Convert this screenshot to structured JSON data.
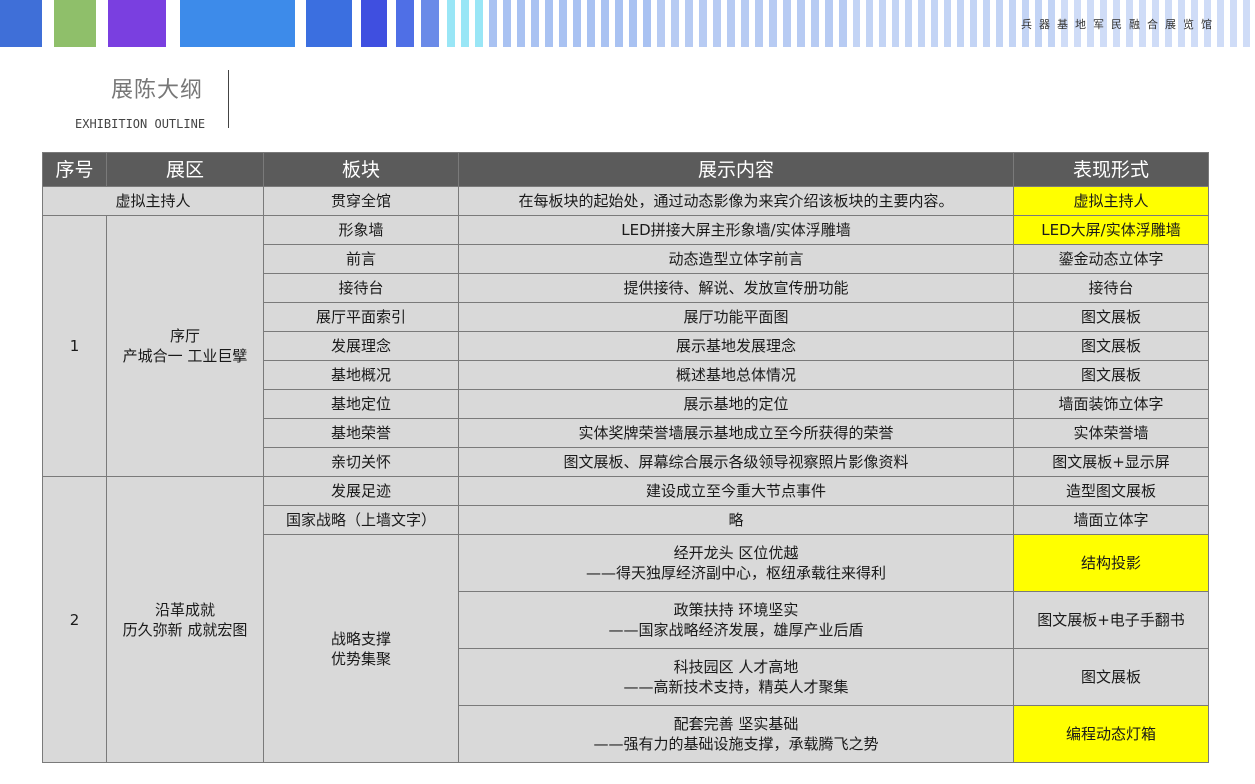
{
  "brand": {
    "hall_name": "兵器基地军民融合展览馆"
  },
  "colors": {
    "header_bg": "#5b5b5b",
    "cell_bg": "#d9d9d9",
    "highlight": "#ffff00",
    "bar_colors": [
      "#3f6fd8",
      "#8fbf6a",
      "#7a3fe0",
      "#3d8bea",
      "#3b6fe0",
      "#3f4fe0",
      "#6a8ae8",
      "#99e6f6",
      "#a9c2f2"
    ]
  },
  "heading": {
    "title": "展陈大纲",
    "subtitle": "EXHIBITION OUTLINE"
  },
  "table": {
    "headers": {
      "no": "序号",
      "zone": "展区",
      "section": "板块",
      "content": "展示内容",
      "form": "表现形式"
    },
    "intro": {
      "zone": "虚拟主持人",
      "section": "贯穿全馆",
      "content": "在每板块的起始处，通过动态影像为来宾介绍该板块的主要内容。",
      "form": "虚拟主持人"
    },
    "group1": {
      "no": "1",
      "zone_line1": "序厅",
      "zone_line2": "产城合一 工业巨擘",
      "rows": [
        {
          "section": "形象墙",
          "content": "LED拼接大屏主形象墙/实体浮雕墙",
          "form": "LED大屏/实体浮雕墙"
        },
        {
          "section": "前言",
          "content": "动态造型立体字前言",
          "form": "鎏金动态立体字"
        },
        {
          "section": "接待台",
          "content": "提供接待、解说、发放宣传册功能",
          "form": "接待台"
        },
        {
          "section": "展厅平面索引",
          "content": "展厅功能平面图",
          "form": "图文展板"
        },
        {
          "section": "发展理念",
          "content": "展示基地发展理念",
          "form": "图文展板"
        },
        {
          "section": "基地概况",
          "content": "概述基地总体情况",
          "form": "图文展板"
        },
        {
          "section": "基地定位",
          "content": "展示基地的定位",
          "form": "墙面装饰立体字"
        },
        {
          "section": "基地荣誉",
          "content": "实体奖牌荣誉墙展示基地成立至今所获得的荣誉",
          "form": "实体荣誉墙"
        },
        {
          "section": "亲切关怀",
          "content": "图文展板、屏幕综合展示各级领导视察照片影像资料",
          "form": "图文展板+显示屏"
        }
      ]
    },
    "group2": {
      "no": "2",
      "zone_line1": "沿革成就",
      "zone_line2": "历久弥新 成就宏图",
      "rows": [
        {
          "section": "发展足迹",
          "content": "建设成立至今重大节点事件",
          "form": "造型图文展板"
        },
        {
          "section": "国家战略（上墙文字）",
          "content": "略",
          "form": "墙面立体字"
        }
      ],
      "strategy": {
        "section_line1": "战略支撑",
        "section_line2": "优势集聚",
        "rows": [
          {
            "line1": "经开龙头 区位优越",
            "line2": "——得天独厚经济副中心，枢纽承载往来得利",
            "form": "结构投影"
          },
          {
            "line1": "政策扶持 环境坚实",
            "line2": "——国家战略经济发展，雄厚产业后盾",
            "form": "图文展板+电子手翻书"
          },
          {
            "line1": "科技园区 人才高地",
            "line2": "——高新技术支持，精英人才聚集",
            "form": "图文展板"
          },
          {
            "line1": "配套完善 坚实基础",
            "line2": "——强有力的基础设施支撑，承载腾飞之势",
            "form": "编程动态灯箱"
          }
        ]
      }
    }
  }
}
